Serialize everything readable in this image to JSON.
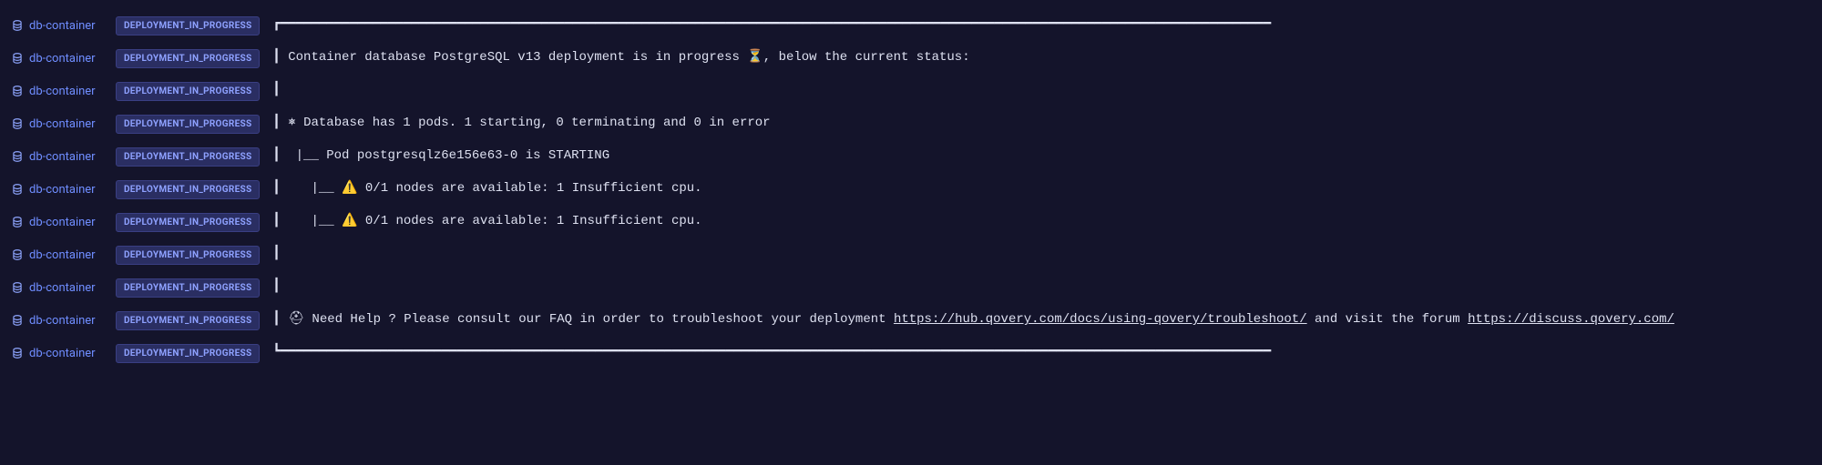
{
  "source_label": "db-container",
  "status_badge": "DEPLOYMENT_IN_PROGRESS",
  "rows": [
    {
      "parts": [
        {
          "t": "text",
          "v": "┏━━━━━━━━━━━━━━━━━━━━━━━━━━━━━━━━━━━━━━━━━━━━━━━━━━━━━━━━━━━━━━━━━━━━━━━━━━━━━━━━━━━━━━━━━━━━━━━━━━━━━━━━━━━━━━━━━━━━━━━━━━━━━━━━━"
        }
      ]
    },
    {
      "parts": [
        {
          "t": "text",
          "v": "┃ Container database PostgreSQL v13 deployment is in progress ⏳, below the current status:"
        }
      ]
    },
    {
      "parts": [
        {
          "t": "text",
          "v": "┃"
        }
      ]
    },
    {
      "parts": [
        {
          "t": "text",
          "v": "┃ ⎈ Database has 1 pods. 1 starting, 0 terminating and 0 in error"
        }
      ]
    },
    {
      "parts": [
        {
          "t": "text",
          "v": "┃  |__ Pod postgresqlz6e156e63-0 is STARTING"
        }
      ]
    },
    {
      "parts": [
        {
          "t": "text",
          "v": "┃    |__ ⚠️ 0/1 nodes are available: 1 Insufficient cpu."
        }
      ]
    },
    {
      "parts": [
        {
          "t": "text",
          "v": "┃    |__ ⚠️ 0/1 nodes are available: 1 Insufficient cpu."
        }
      ]
    },
    {
      "parts": [
        {
          "t": "text",
          "v": "┃"
        }
      ]
    },
    {
      "parts": [
        {
          "t": "text",
          "v": "┃"
        }
      ]
    },
    {
      "parts": [
        {
          "t": "text",
          "v": "┃ ⛑ Need Help ? Please consult our FAQ in order to troubleshoot your deployment "
        },
        {
          "t": "link",
          "v": "https://hub.qovery.com/docs/using-qovery/troubleshoot/"
        },
        {
          "t": "text",
          "v": " and visit the forum "
        },
        {
          "t": "link",
          "v": "https://discuss.qovery.com/"
        }
      ]
    },
    {
      "parts": [
        {
          "t": "text",
          "v": "┗━━━━━━━━━━━━━━━━━━━━━━━━━━━━━━━━━━━━━━━━━━━━━━━━━━━━━━━━━━━━━━━━━━━━━━━━━━━━━━━━━━━━━━━━━━━━━━━━━━━━━━━━━━━━━━━━━━━━━━━━━━━━━━━━━"
        }
      ]
    }
  ]
}
